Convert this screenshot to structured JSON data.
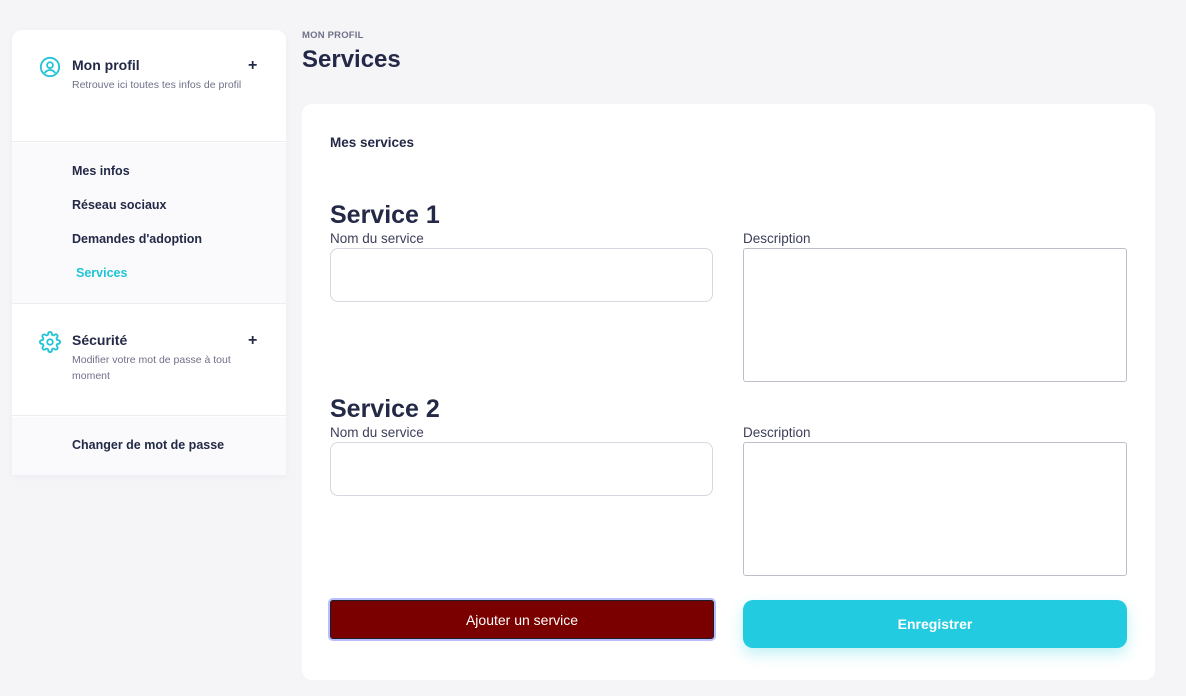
{
  "sidebar": {
    "profile": {
      "title": "Mon profil",
      "subtitle": "Retrouve ici toutes tes infos de profil",
      "expand": "+",
      "icon": "user-circle-icon",
      "items": [
        {
          "label": "Mes infos"
        },
        {
          "label": "Réseau sociaux"
        },
        {
          "label": "Demandes d'adoption"
        },
        {
          "label": "Services",
          "active": true
        }
      ]
    },
    "security": {
      "title": "Sécurité",
      "subtitle": "Modifier votre mot de passe à tout moment",
      "expand": "+",
      "icon": "gear-icon",
      "items": [
        {
          "label": "Changer de mot de passe"
        }
      ]
    }
  },
  "header": {
    "breadcrumb": "MON PROFIL",
    "title": "Services"
  },
  "card": {
    "title": "Mes services",
    "services": [
      {
        "heading": "Service 1",
        "name_label": "Nom du service",
        "name_value": "",
        "desc_label": "Description",
        "desc_value": ""
      },
      {
        "heading": "Service 2",
        "name_label": "Nom du service",
        "name_value": "",
        "desc_label": "Description",
        "desc_value": ""
      }
    ],
    "add_button": "Ajouter un service",
    "save_button": "Enregistrer"
  },
  "colors": {
    "accent": "#23cbe0",
    "active_link": "#21c4d6",
    "add_button": "#7a0000",
    "text_dark": "#232946"
  }
}
